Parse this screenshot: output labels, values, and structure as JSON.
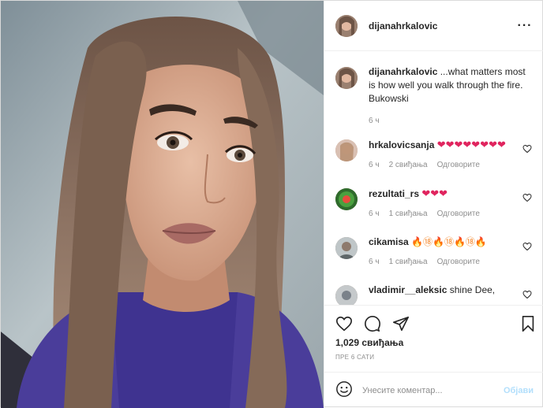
{
  "post": {
    "author": "dijanahrkalovic",
    "more_icon": "ellipsis-icon"
  },
  "caption": {
    "username": "dijanahrkalovic",
    "text": "...what matters most is how well you walk through the fire. Bukowski",
    "time": "6 ч"
  },
  "comments": [
    {
      "username": "hrkalovicsanja",
      "text_emoji": "❤❤❤❤❤❤❤❤",
      "time": "6 ч",
      "likes": "2 свиђања",
      "reply": "Одговорите",
      "avatar_color": "#c9a28e"
    },
    {
      "username": "rezultati_rs",
      "text_emoji": "❤❤❤",
      "time": "6 ч",
      "likes": "1 свиђања",
      "reply": "Одговорите",
      "avatar_color": "#3f8f3a"
    },
    {
      "username": "cikamisa",
      "text_emoji": "🔥⑱🔥⑱🔥⑱🔥",
      "time": "6 ч",
      "likes": "1 свиђања",
      "reply": "Одговорите",
      "avatar_color": "#8d9596"
    },
    {
      "username": "vladimir__aleksic",
      "text": "shine Dee,",
      "avatar_color": "#9aa0a4"
    }
  ],
  "actions": {
    "likes_text": "1,029 свиђања",
    "posted_time": "ПРЕ 6 САТИ"
  },
  "add_comment": {
    "placeholder": "Унесите коментар...",
    "post_label": "Објави"
  },
  "colors": {
    "accent_disabled": "#b2dffc",
    "heart_red": "#e0245e",
    "muted_text": "#8e8e8e"
  }
}
